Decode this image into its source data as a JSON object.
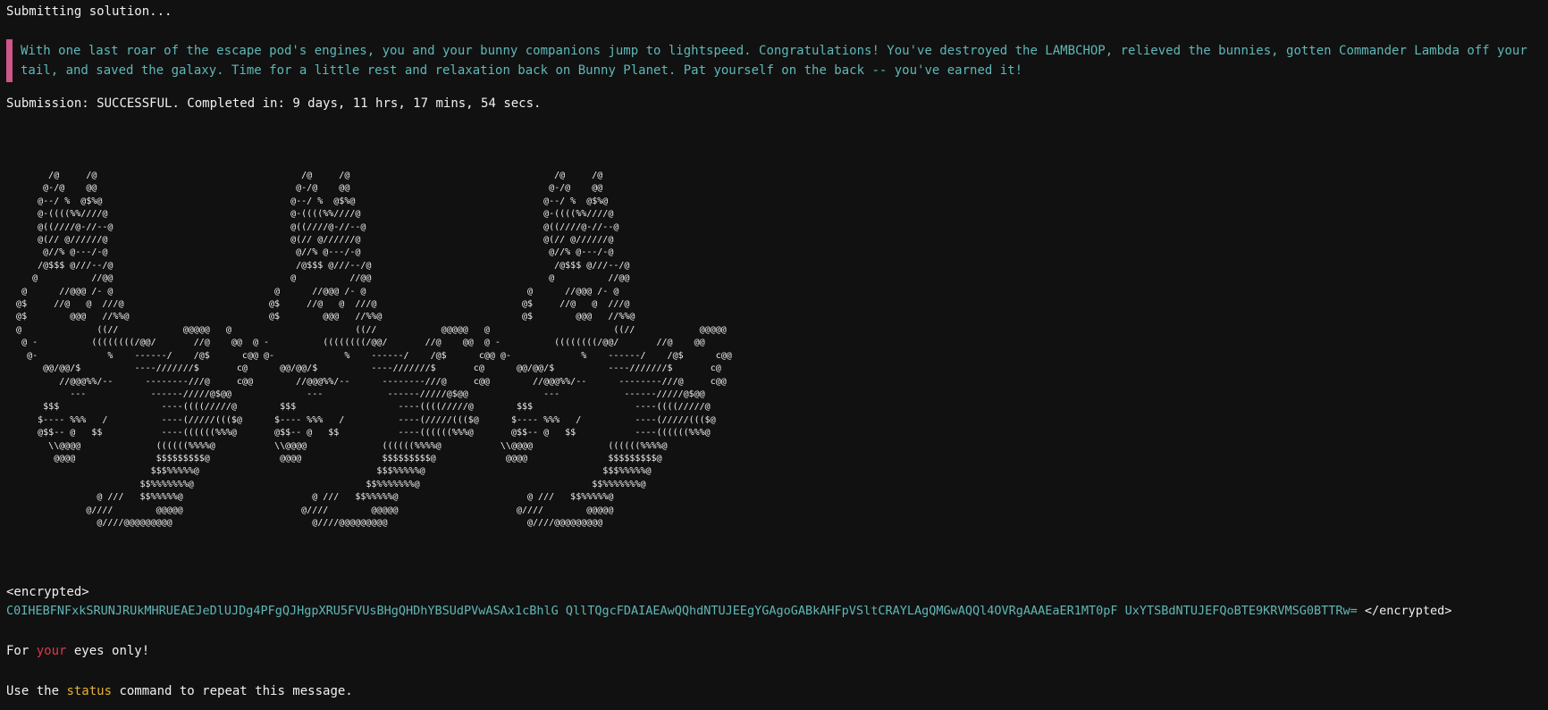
{
  "terminal": {
    "submitting": "Submitting solution...",
    "story": "With one last roar of the escape pod's engines, you and your bunny companions jump to lightspeed. Congratulations! You've destroyed the LAMBCHOP, relieved the bunnies, gotten Commander Lambda off your tail, and saved the galaxy. Time for a little rest and relaxation back on Bunny Planet. Pat yourself on the back -- you've earned it!",
    "submission_label": "Submission: ",
    "submission_status": "SUCCESSFUL",
    "submission_rest": ". Completed in: 9 days, 11 hrs, 17 mins, 54 secs.",
    "encrypted_open": "<encrypted>",
    "encrypted_value": "C0IHEBFNFxkSRUNJRUkMHRUEAEJeDlUJDg4PFgQJHgpXRU5FVUsBHgQHDhYBSUdPVwASAx1cBhlG QllTQgcFDAIAEAwQQhdNTUJEEgYGAgoGABkAHFpVSltCRAYLAgQMGwAQQl4OVRgAAAEaER1MT0pF UxYTSBdNTUJEFQoBTE9KRVMSG0BTTRw=",
    "encrypted_close": " </encrypted>",
    "eyes_pre": "For ",
    "eyes_red": "your",
    "eyes_post": " eyes only!",
    "status_pre": "Use the ",
    "status_cmd": "status",
    "status_post": " command to repeat this message."
  },
  "colors": {
    "background": "#111111",
    "text": "#f0f0f0",
    "cyan": "#5fb8b8",
    "quote_bar": "#d0558a",
    "red": "#e0364a",
    "yellow": "#e5b233"
  }
}
